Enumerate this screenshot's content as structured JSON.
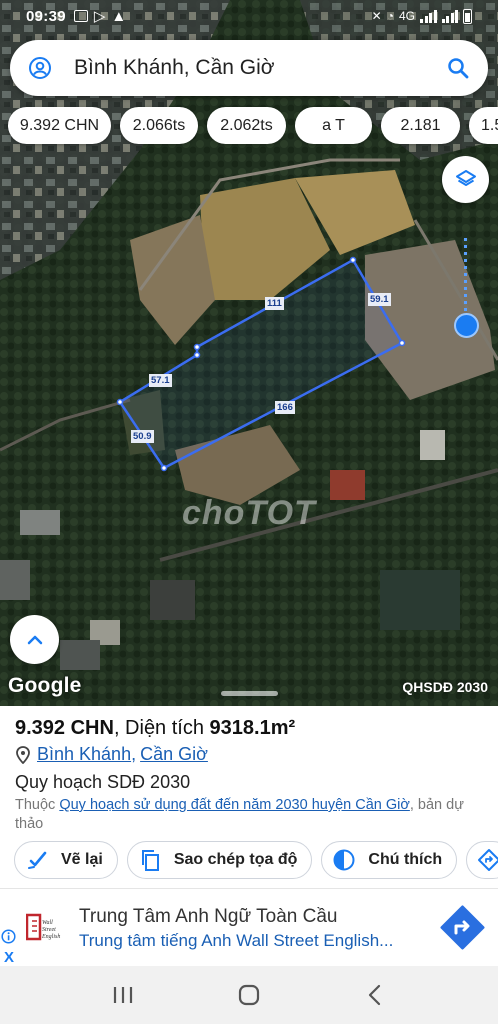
{
  "status_bar": {
    "time": "09:39",
    "network": "4G"
  },
  "search": {
    "query": "Bình Khánh, Cần Giờ"
  },
  "chips": [
    "9.392 CHN",
    "2.066ts",
    "2.062ts",
    "a T",
    "2.181",
    "1.5"
  ],
  "map": {
    "edge_labels": [
      "111",
      "59.1",
      "57.1",
      "166",
      "50.9"
    ],
    "watermark": "choTOT",
    "google_logo": "Google",
    "layer_name": "QHSDĐ 2030",
    "icons": [
      "layers-icon",
      "chevron-up-icon"
    ]
  },
  "sheet": {
    "title_code": "9.392 CHN",
    "title_sep": ", Diện tích ",
    "area_value": "9318.1m²",
    "addr_commune": "Bình Khánh",
    "addr_district": "Cần Giờ",
    "plan": "Quy hoạch SDĐ 2030",
    "desc_prefix": "Thuộc ",
    "desc_link": "Quy hoạch sử dụng đất đến năm 2030 huyện Cần Giờ",
    "desc_suffix": ", bản dự thảo"
  },
  "actions": {
    "redraw": "Vẽ lại",
    "copy_coords": "Sao chép tọa độ",
    "legend": "Chú thích"
  },
  "ad": {
    "title": "Trung Tâm Anh Ngữ Toàn Cầu",
    "subtitle": "Trung tâm tiếng Anh Wall Street English...",
    "logo_text": "Wall Street English",
    "close": "X"
  },
  "colors": {
    "accent": "#1a7cf2",
    "link": "#1a5fb4",
    "polygon": "#3b6df0"
  }
}
